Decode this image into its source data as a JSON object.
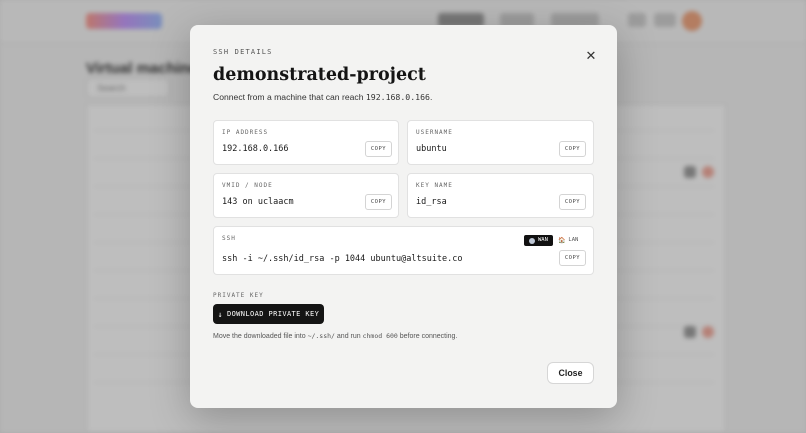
{
  "background": {
    "title": "Virtual machines",
    "search_placeholder": "Search"
  },
  "modal": {
    "eyebrow": "SSH DETAILS",
    "title": "demonstrated-project",
    "subtitle_prefix": "Connect from a machine that can reach ",
    "subtitle_ip": "192.168.0.166",
    "subtitle_suffix": ".",
    "cards": {
      "ip": {
        "label": "IP ADDRESS",
        "value": "192.168.0.166",
        "copy": "COPY"
      },
      "username": {
        "label": "USERNAME",
        "value": "ubuntu",
        "copy": "COPY"
      },
      "vmid": {
        "label": "VMID / NODE",
        "value": "143 on uclaacm",
        "copy": "COPY"
      },
      "keyname": {
        "label": "KEY NAME",
        "value": "id_rsa",
        "copy": "COPY"
      },
      "ssh": {
        "label": "SSH",
        "value": "ssh -i ~/.ssh/id_rsa -p 1044 ubuntu@altsuite.co",
        "copy": "COPY",
        "toggle": {
          "wan": "WAN",
          "lan": "LAN",
          "selected": "WAN"
        }
      }
    },
    "private_key": {
      "label": "PRIVATE KEY",
      "button": "DOWNLOAD PRIVATE KEY",
      "hint_prefix": "Move the downloaded file into ",
      "hint_path": "~/.ssh/",
      "hint_mid": " and run ",
      "hint_cmd": "chmod 600",
      "hint_suffix": " before connecting."
    },
    "close_label": "Close"
  },
  "colors": {
    "modal_bg": "#f3f3f2",
    "primary_button": "#141414",
    "card_bg": "#ffffff"
  },
  "icons": {
    "close": "close-icon",
    "download": "download-arrow-icon",
    "wan": "globe-icon",
    "lan": "house-icon"
  }
}
